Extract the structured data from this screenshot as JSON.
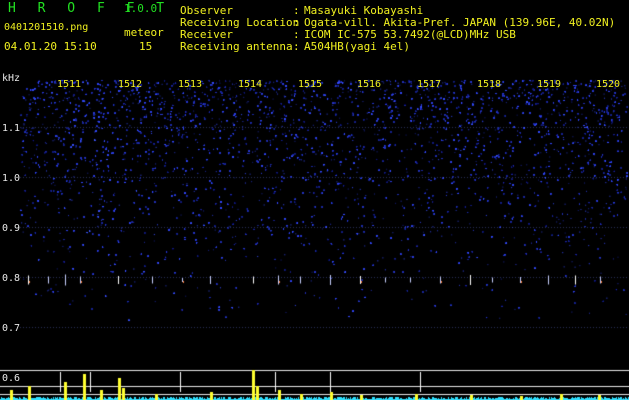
{
  "header": {
    "app_title": "H R O F F T",
    "app_version": "1.0.0",
    "file_name": "0401201510.png",
    "timestamp": "04.01.20 15:10",
    "meteor_label": "meteor",
    "meteor_count": "15"
  },
  "info": [
    {
      "label": "Observer",
      "value": "Masayuki Kobayashi"
    },
    {
      "label": "Receiving Location",
      "value": "Ogata-vill. Akita-Pref. JAPAN (139.96E, 40.02N)"
    },
    {
      "label": "Receiver",
      "value": "ICOM IC-575 53.7492(@LCD)MHz USB"
    },
    {
      "label": "Receiving antenna",
      "value": "A504HB(yagi 4el)"
    }
  ],
  "info_separator": ":",
  "spectrogram": {
    "y_unit": "kHz",
    "time_ticks": [
      "1511",
      "1512",
      "1513",
      "1514",
      "1515",
      "1516",
      "1517",
      "1518",
      "1519",
      "1520"
    ],
    "freq_ticks": [
      "1.1",
      "1.0",
      "0.9",
      "0.8",
      "0.7",
      "0.6"
    ],
    "colors": {
      "background": "#000000",
      "text_green": "#22e022",
      "text_yellow": "#f0f020",
      "noise_blue": "#2a3ed8",
      "echo_line": "#e8e8e8",
      "signal_yellow": "#ffff30",
      "signal_cyan": "#30e0ff"
    }
  }
}
